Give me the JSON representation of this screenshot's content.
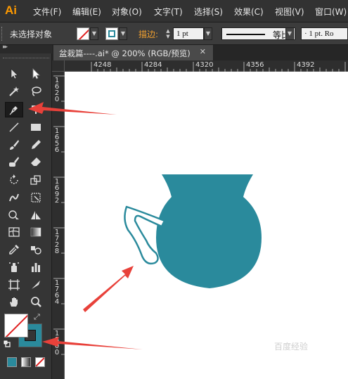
{
  "app": {
    "logo": "Ai"
  },
  "menu": [
    "文件(F)",
    "编辑(E)",
    "对象(O)",
    "文字(T)",
    "选择(S)",
    "效果(C)",
    "视图(V)",
    "窗口(W)"
  ],
  "control": {
    "selection_status": "未选择对象",
    "stroke_label": "描边:",
    "stroke_weight": "1 pt",
    "stroke_profile": "等比",
    "brush_value": "· 1 pt. Ro"
  },
  "tab": {
    "title": "盆栽篇----.ai* @ 200% (RGB/预览)",
    "close": "✕"
  },
  "ruler": {
    "top_labels": [
      "4248",
      "4284",
      "4320",
      "4356",
      "4392"
    ],
    "left_labels": [
      "1620",
      "1656",
      "1692",
      "1728",
      "1764",
      "1800"
    ]
  },
  "toolbox": {
    "tools": [
      "selection-tool-icon",
      "direct-selection-tool-icon",
      "magic-wand-tool-icon",
      "lasso-tool-icon",
      "pen-tool-icon",
      "type-tool-icon",
      "line-segment-tool-icon",
      "rectangle-tool-icon",
      "paintbrush-tool-icon",
      "pencil-tool-icon",
      "blob-brush-tool-icon",
      "eraser-tool-icon",
      "rotate-tool-icon",
      "scale-tool-icon",
      "warp-tool-icon",
      "free-transform-tool-icon",
      "shape-builder-tool-icon",
      "perspective-grid-tool-icon",
      "mesh-tool-icon",
      "gradient-tool-icon",
      "eyedropper-tool-icon",
      "blend-tool-icon",
      "symbol-sprayer-tool-icon",
      "column-graph-tool-icon",
      "artboard-tool-icon",
      "slice-tool-icon",
      "hand-tool-icon",
      "zoom-tool-icon"
    ],
    "selected_tool": "pen-tool-icon"
  },
  "colors": {
    "accent": "#ff9a00",
    "teal_fill": "#2a8a9c",
    "arrow_red": "#e8413a"
  },
  "watermark": "百度经验"
}
